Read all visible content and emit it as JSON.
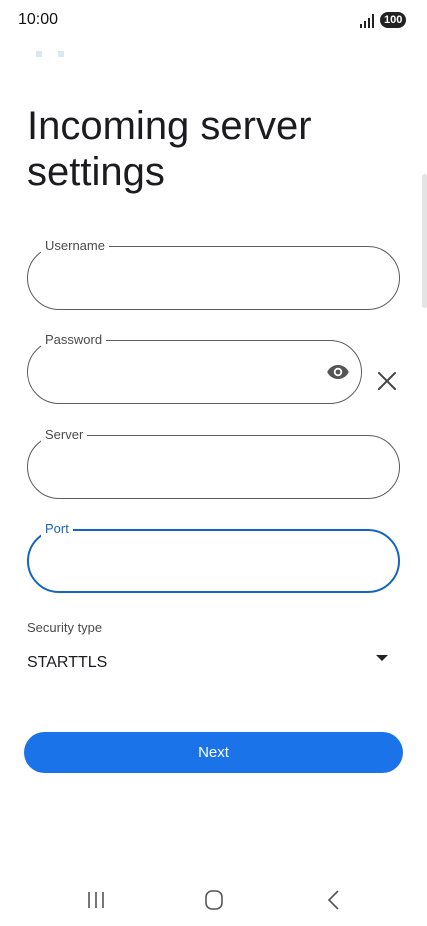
{
  "status_bar": {
    "time": "10:00",
    "battery": "100",
    "signal_icon": "signal-bars-icon"
  },
  "page": {
    "title": "Incoming server settings"
  },
  "fields": {
    "username": {
      "label": "Username",
      "value": ""
    },
    "password": {
      "label": "Password",
      "value": "",
      "toggle_icon": "eye-icon",
      "clear_icon": "close-icon"
    },
    "server": {
      "label": "Server",
      "value": ""
    },
    "port": {
      "label": "Port",
      "value": "",
      "focused": true
    }
  },
  "security": {
    "label": "Security type",
    "selected": "STARTTLS",
    "arrow_icon": "dropdown-arrow-icon"
  },
  "actions": {
    "next_label": "Next"
  },
  "nav": {
    "recents_icon": "recents-icon",
    "home_icon": "home-icon",
    "back_icon": "back-icon"
  },
  "colors": {
    "accent": "#1a73e8",
    "focus": "#1565c0",
    "outline": "#5c5c5c"
  }
}
